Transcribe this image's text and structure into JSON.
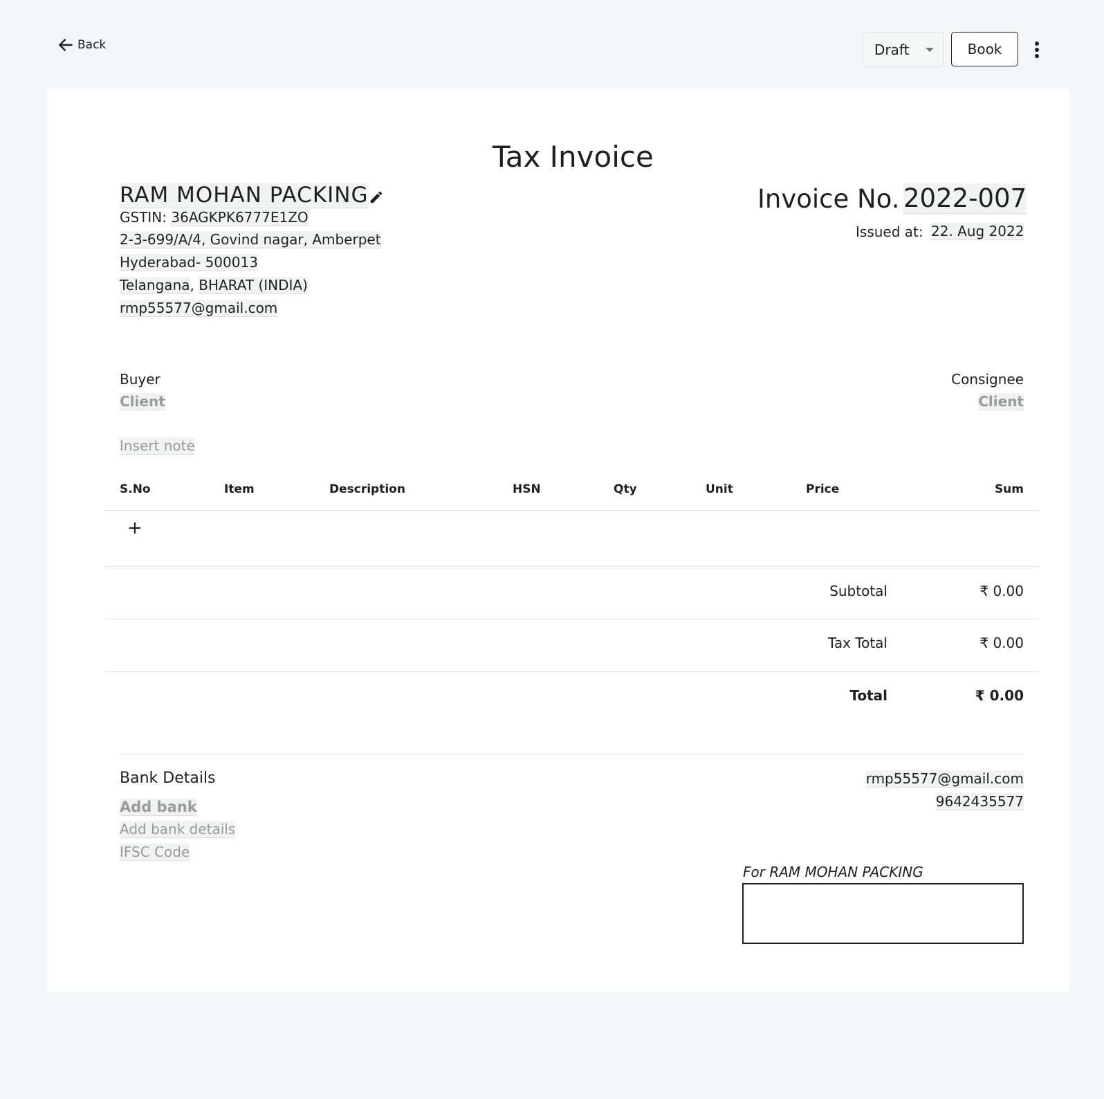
{
  "topbar": {
    "back_label": "Back",
    "status": "Draft",
    "book_label": "Book"
  },
  "invoice": {
    "title": "Tax Invoice",
    "number_label": "Invoice No.",
    "number": "2022-007",
    "issued_label": "Issued at:",
    "issued_date": "22. Aug 2022"
  },
  "seller": {
    "name": "RAM MOHAN PACKING",
    "gstin_label": "GSTIN:",
    "gstin": "36AGKPK6777E1ZO",
    "address_line1": "2-3-699/A/4, Govind nagar, Amberpet",
    "address_line2": "Hyderabad- 500013",
    "state": "Telangana",
    "comma": ",",
    "country": "BHARAT (INDIA)",
    "email": "rmp55577@gmail.com"
  },
  "parties": {
    "buyer_label": "Buyer",
    "buyer_value": "Client",
    "consignee_label": "Consignee",
    "consignee_value": "Client",
    "note_placeholder": "Insert note"
  },
  "table": {
    "columns": [
      "S.No",
      "Item",
      "Description",
      "HSN",
      "Qty",
      "Unit",
      "Price",
      "Sum"
    ],
    "add_row": "+"
  },
  "totals": {
    "subtotal_label": "Subtotal",
    "subtotal": "₹ 0.00",
    "tax_label": "Tax Total",
    "tax": "₹ 0.00",
    "total_label": "Total",
    "total": "₹ 0.00"
  },
  "bank": {
    "title": "Bank Details",
    "name_placeholder": "Add bank",
    "details_placeholder": "Add bank details",
    "ifsc_placeholder": "IFSC Code"
  },
  "contact": {
    "email": "rmp55577@gmail.com",
    "phone": "9642435577"
  },
  "signature": {
    "for_label": "For RAM MOHAN PACKING"
  }
}
